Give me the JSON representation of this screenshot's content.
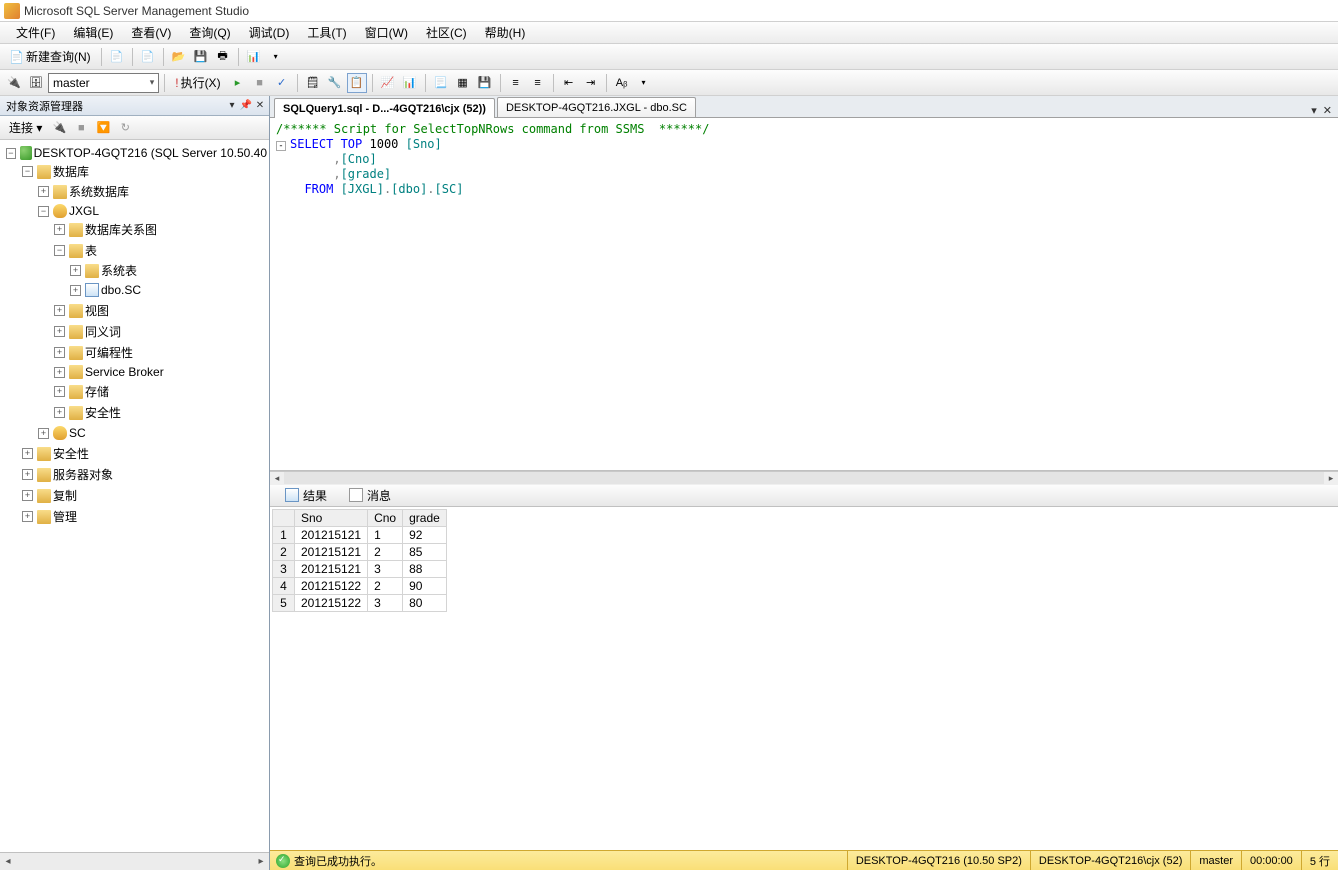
{
  "app": {
    "title": "Microsoft SQL Server Management Studio"
  },
  "menu": {
    "items": [
      "文件(F)",
      "编辑(E)",
      "查看(V)",
      "查询(Q)",
      "调试(D)",
      "工具(T)",
      "窗口(W)",
      "社区(C)",
      "帮助(H)"
    ]
  },
  "toolbar1": {
    "newQuery": "新建查询(N)"
  },
  "toolbar2": {
    "database": "master",
    "execute": "执行(X)"
  },
  "sidebar": {
    "title": "对象资源管理器",
    "connectLabel": "连接 ▾",
    "server": "DESKTOP-4GQT216 (SQL Server 10.50.40",
    "nodes": {
      "databases": "数据库",
      "sysdb": "系统数据库",
      "jxgl": "JXGL",
      "dbdiagram": "数据库关系图",
      "tables": "表",
      "systables": "系统表",
      "dbosc": "dbo.SC",
      "views": "视图",
      "synonyms": "同义词",
      "programmability": "可编程性",
      "servicebroker": "Service Broker",
      "storage": "存储",
      "dbsecurity": "安全性",
      "sc": "SC",
      "security": "安全性",
      "serverobjects": "服务器对象",
      "replication": "复制",
      "management": "管理"
    }
  },
  "tabs": {
    "active": "SQLQuery1.sql - D...-4GQT216\\cjx (52))",
    "inactive": "DESKTOP-4GQT216.JXGL - dbo.SC"
  },
  "sql": {
    "comment": "/****** Script for SelectTopNRows command from SSMS  ******/",
    "l1a": "SELECT",
    "l1b": " TOP",
    "l1c": " 1000 ",
    "l1d": "[Sno]",
    "l2a": "      ,",
    "l2b": "[Cno]",
    "l3a": "      ,",
    "l3b": "[grade]",
    "l4a": "  FROM ",
    "l4b": "[JXGL]",
    "l4c": ".",
    "l4d": "[dbo]",
    "l4e": ".",
    "l4f": "[SC]"
  },
  "resultTabs": {
    "results": "结果",
    "messages": "消息"
  },
  "results": {
    "cols": [
      "Sno",
      "Cno",
      "grade"
    ],
    "rows": [
      {
        "n": "1",
        "Sno": "201215121",
        "Cno": "1",
        "grade": "92"
      },
      {
        "n": "2",
        "Sno": "201215121",
        "Cno": "2",
        "grade": "85"
      },
      {
        "n": "3",
        "Sno": "201215121",
        "Cno": "3",
        "grade": "88"
      },
      {
        "n": "4",
        "Sno": "201215122",
        "Cno": "2",
        "grade": "90"
      },
      {
        "n": "5",
        "Sno": "201215122",
        "Cno": "3",
        "grade": "80"
      }
    ]
  },
  "status": {
    "msg": "查询已成功执行。",
    "server": "DESKTOP-4GQT216 (10.50 SP2)",
    "user": "DESKTOP-4GQT216\\cjx (52)",
    "db": "master",
    "time": "00:00:00",
    "rows": "5 行"
  }
}
